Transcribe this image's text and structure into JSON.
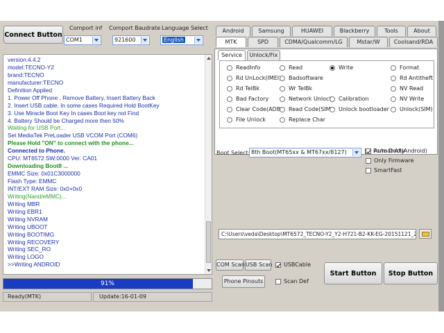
{
  "header": {
    "connect_button": "Connect Button",
    "comport_label": "Comport inf",
    "comport_value": "COM1",
    "baud_label": "Comport Baudrate",
    "baud_value": "921600",
    "language_label": "Language Select",
    "language_value": "English"
  },
  "log": {
    "lines": [
      {
        "text": "version:4.4.2",
        "color": "#1b2fa8"
      },
      {
        "text": "model:TECNO-Y2",
        "color": "#1b2fa8"
      },
      {
        "text": "brand:TECNO",
        "color": "#1b2fa8"
      },
      {
        "text": "manufacturer:TECNO",
        "color": "#1b2fa8"
      },
      {
        "text": "Definition Applied",
        "color": "#1b2fa8"
      },
      {
        "text": "1. Power Off Phone , Remove Battery, Insert Battery Back",
        "color": "#1b2fa8"
      },
      {
        "text": "2. Insert USB cable. In some cases Required Hold BootKey",
        "color": "#1b2fa8"
      },
      {
        "text": "3. Use Miracle Boot Key In cases Boot key not Find",
        "color": "#1b2fa8"
      },
      {
        "text": "4. Battery Should be Charged more then 50%",
        "color": "#1b2fa8"
      },
      {
        "text": "Waiting for USB Port...",
        "color": "#2aa12a"
      },
      {
        "text": "Set MediaTek PreLoader USB VCOM Port (COM6)",
        "color": "#1b2fa8"
      },
      {
        "text": "Please Hold \"ON\" to connect with the phone...",
        "color": "#1e8f1e",
        "bold": true
      },
      {
        "text": "Connected to Phone.",
        "color": "#1b2fa8",
        "bold": true
      },
      {
        "text": "CPU: MT6572 SW:0000 Ver: CA01",
        "color": "#1b2fa8"
      },
      {
        "text": "Downloading Boot8 ...",
        "color": "#1e8f1e",
        "bold": true
      },
      {
        "text": "EMMC Size: 0x01C3000000",
        "color": "#1b2fa8"
      },
      {
        "text": "Flash Type: EMMC",
        "color": "#1b2fa8"
      },
      {
        "text": "INT/EXT RAM  Size: 0x0+0x0",
        "color": "#1b2fa8"
      },
      {
        "text": "Writing(Nand/eMMC)...",
        "color": "#2aa12a"
      },
      {
        "text": "Writing MBR",
        "color": "#1b2fa8"
      },
      {
        "text": "Writing EBR1",
        "color": "#1b2fa8"
      },
      {
        "text": "Writing NVRAM",
        "color": "#1b2fa8"
      },
      {
        "text": "Writing UBOOT",
        "color": "#1b2fa8"
      },
      {
        "text": "Writing BOOTIMG",
        "color": "#1b2fa8"
      },
      {
        "text": "Writing RECOVERY",
        "color": "#1b2fa8"
      },
      {
        "text": "Writing SEC_RO",
        "color": "#1b2fa8"
      },
      {
        "text": "Writing LOGO",
        "color": "#1b2fa8"
      },
      {
        "text": ">>Writing ANDROID",
        "color": "#1b2fa8"
      }
    ]
  },
  "progress": {
    "label": "91%",
    "value": 0.91
  },
  "status": {
    "left": "Ready(MTK)",
    "right": "Update:16-01-09"
  },
  "tabs_row1": [
    "Android",
    "Samsung",
    "HUAWEI",
    "Blackberry",
    "Tools",
    "About"
  ],
  "tabs_row2": [
    "MTK",
    "SPD",
    "CDMA/Qualcomm/LG",
    "Mstar/W",
    "Coolsand/RDA"
  ],
  "subtabs": [
    "Service",
    "Unlock/Fix"
  ],
  "service_options": [
    [
      "ReadInfo",
      "Read",
      "Write",
      "Format"
    ],
    [
      "Rd UnLock(IMEI)",
      "Badsoftware",
      "",
      "Rd Antitheft"
    ],
    [
      "Rd TelBk",
      "Wr TelBk",
      "",
      "NV Read"
    ],
    [
      "Bad Factory",
      "Network Unlock",
      "Calibration",
      "NV Write"
    ],
    [
      "Clear Code(ADB)",
      "Read Code(SIM)",
      "Unlock bootloader",
      "Unlock(SIM)"
    ],
    [
      "File Unlock",
      "Replace Char",
      "",
      ""
    ]
  ],
  "selected_option": "Write",
  "boot": {
    "label": "Boot Select:",
    "value": "8th Boot(MT65xx & MT67xx/8127)",
    "auto_detect": "Auto Decty",
    "only_firmware": "Only Firmware",
    "smart_fast": "SmartFast",
    "format_all": "Format All(Android)"
  },
  "file_path": "C:\\Users\\veda\\Desktop\\MT6572_TECNO-Y2_Y2-H721-B2-KK-EG-20151121_20",
  "bottom": {
    "com_scan": "COM Scan",
    "usb_scan": "USB Scan",
    "usb_cable": "USBCable",
    "phone_pinouts": "Phone Pinouts",
    "scan_def": "Scan Def",
    "start_button": "Start Button",
    "stop_button": "Stop Button"
  },
  "colors": {
    "accent": "#1a3cc0",
    "log_blue": "#1b2fa8",
    "log_green": "#1e8f1e",
    "highlight": "#1756b8"
  }
}
